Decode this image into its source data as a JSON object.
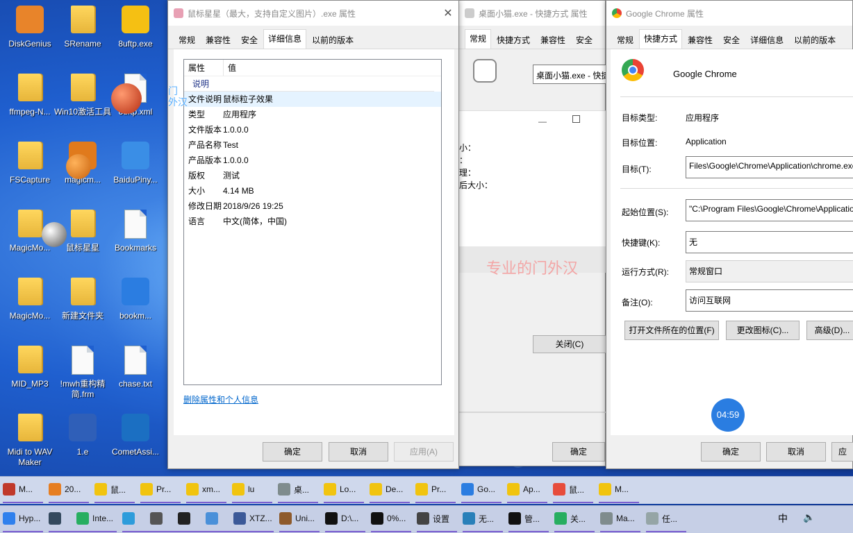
{
  "desktop_icons": [
    {
      "label": "DiskGenius",
      "kind": "app",
      "color": "#e8842a"
    },
    {
      "label": "SRename",
      "kind": "folder"
    },
    {
      "label": "8uftp.exe",
      "kind": "app",
      "color": "#f5c013"
    },
    {
      "label": "ffmpeg-N...",
      "kind": "folder"
    },
    {
      "label": "Win10激活工具",
      "kind": "folder"
    },
    {
      "label": "8uftp.xml",
      "kind": "doc"
    },
    {
      "label": "FSCapture",
      "kind": "folder"
    },
    {
      "label": "magicm...",
      "kind": "app",
      "color": "#e07a1c"
    },
    {
      "label": "BaiduPiny...",
      "kind": "app",
      "color": "#3a8ee6"
    },
    {
      "label": "MagicMo...",
      "kind": "folder"
    },
    {
      "label": "鼠标星星",
      "kind": "folder"
    },
    {
      "label": "Bookmarks",
      "kind": "doc"
    },
    {
      "label": "MagicMo...",
      "kind": "folder"
    },
    {
      "label": "新建文件夹",
      "kind": "folder"
    },
    {
      "label": "bookm...",
      "kind": "app",
      "color": "#2b7de1"
    },
    {
      "label": "MID_MP3",
      "kind": "folder"
    },
    {
      "label": "!mwh重构精简.frm",
      "kind": "doc"
    },
    {
      "label": "chase.txt",
      "kind": "doc"
    },
    {
      "label": "Midi to WAV Maker",
      "kind": "folder"
    },
    {
      "label": "1.e",
      "kind": "app",
      "color": "#2f5fb8"
    },
    {
      "label": "CometAssi...",
      "kind": "app",
      "color": "#1b6fc2"
    }
  ],
  "win1": {
    "title": "鼠标星星（最大，支持自定义图片）.exe 属性",
    "tabs": [
      "常规",
      "兼容性",
      "安全",
      "详细信息",
      "以前的版本"
    ],
    "active_tab": 3,
    "col_property": "属性",
    "col_value": "值",
    "section": "说明",
    "rows": [
      {
        "k": "文件说明",
        "v": "鼠标粒子效果"
      },
      {
        "k": "类型",
        "v": "应用程序"
      },
      {
        "k": "文件版本",
        "v": "1.0.0.0"
      },
      {
        "k": "产品名称",
        "v": "Test"
      },
      {
        "k": "产品版本",
        "v": "1.0.0.0"
      },
      {
        "k": "版权",
        "v": "测试"
      },
      {
        "k": "大小",
        "v": "4.14 MB"
      },
      {
        "k": "修改日期",
        "v": "2018/9/26 19:25"
      },
      {
        "k": "语言",
        "v": "中文(简体，中国)"
      }
    ],
    "link": "删除属性和个人信息",
    "ok": "确定",
    "cancel": "取消",
    "apply": "应用(A)"
  },
  "win2": {
    "title": "桌面小猫.exe - 快捷方式 属性",
    "tabs": [
      "常规",
      "快捷方式",
      "兼容性",
      "安全"
    ],
    "field": "桌面小猫.exe - 快捷",
    "labels": [
      "小：",
      "：",
      "理：",
      "后大小："
    ],
    "close_btn": "关闭(C)",
    "ok": "确定"
  },
  "win3": {
    "title": "Google Chrome 属性",
    "tabs": [
      "常规",
      "快捷方式",
      "兼容性",
      "安全",
      "详细信息",
      "以前的版本"
    ],
    "active_tab": 1,
    "app_name": "Google Chrome",
    "target_type_label": "目标类型:",
    "target_type": "应用程序",
    "target_loc_label": "目标位置:",
    "target_loc": "Application",
    "target_label": "目标(T):",
    "target": "Files\\Google\\Chrome\\Application\\chrome.exe\"",
    "start_label": "起始位置(S):",
    "start": "\"C:\\Program Files\\Google\\Chrome\\Application\"",
    "hotkey_label": "快捷键(K):",
    "hotkey": "无",
    "run_label": "运行方式(R):",
    "run": "常规窗口",
    "comment_label": "备注(O):",
    "comment": "访问互联网",
    "btn_open": "打开文件所在的位置(F)",
    "btn_icon": "更改图标(C)...",
    "btn_adv": "高级(D)...",
    "ok": "确定",
    "cancel": "取消",
    "apply": "应"
  },
  "watermark": "专业的门外汉",
  "overlay_text": "门\n外汉",
  "clock": "04:59",
  "taskbar_top": [
    {
      "label": "M...",
      "color": "#c0392b"
    },
    {
      "label": "20...",
      "color": "#e67e22"
    },
    {
      "label": "鼠...",
      "color": "#f1c40f"
    },
    {
      "label": "Pr...",
      "color": "#f1c40f"
    },
    {
      "label": "xm...",
      "color": "#f1c40f"
    },
    {
      "label": "lu",
      "color": "#f1c40f"
    },
    {
      "label": "桌...",
      "color": "#7f8c8d"
    },
    {
      "label": "Lo...",
      "color": "#f1c40f"
    },
    {
      "label": "De...",
      "color": "#f1c40f"
    },
    {
      "label": "Pr...",
      "color": "#f1c40f"
    },
    {
      "label": "Go...",
      "color": "#2b7de1"
    },
    {
      "label": "Ap...",
      "color": "#f1c40f"
    },
    {
      "label": "鼠...",
      "color": "#e74c3c"
    },
    {
      "label": "M...",
      "color": "#f1c40f"
    }
  ],
  "taskbar_bottom": [
    {
      "label": "Hyp...",
      "color": "#2f80ed"
    },
    {
      "label": "",
      "color": "#34495e"
    },
    {
      "label": "Inte...",
      "color": "#27ae60"
    },
    {
      "label": "",
      "color": "#2d9cdb"
    },
    {
      "label": "",
      "color": "#555"
    },
    {
      "label": "",
      "color": "#222"
    },
    {
      "label": "",
      "color": "#4a90d9"
    },
    {
      "label": "XTZ...",
      "color": "#3b5998"
    },
    {
      "label": "Uni...",
      "color": "#8e5a2b"
    },
    {
      "label": "D:\\...",
      "color": "#111"
    },
    {
      "label": "0%...",
      "color": "#111"
    },
    {
      "label": "设置",
      "color": "#444"
    },
    {
      "label": "无...",
      "color": "#2980b9"
    },
    {
      "label": "管...",
      "color": "#111"
    },
    {
      "label": "关...",
      "color": "#27ae60"
    },
    {
      "label": "Ma...",
      "color": "#7f8c8d"
    },
    {
      "label": "任...",
      "color": "#95a5a6"
    }
  ],
  "tray_ime": "中"
}
